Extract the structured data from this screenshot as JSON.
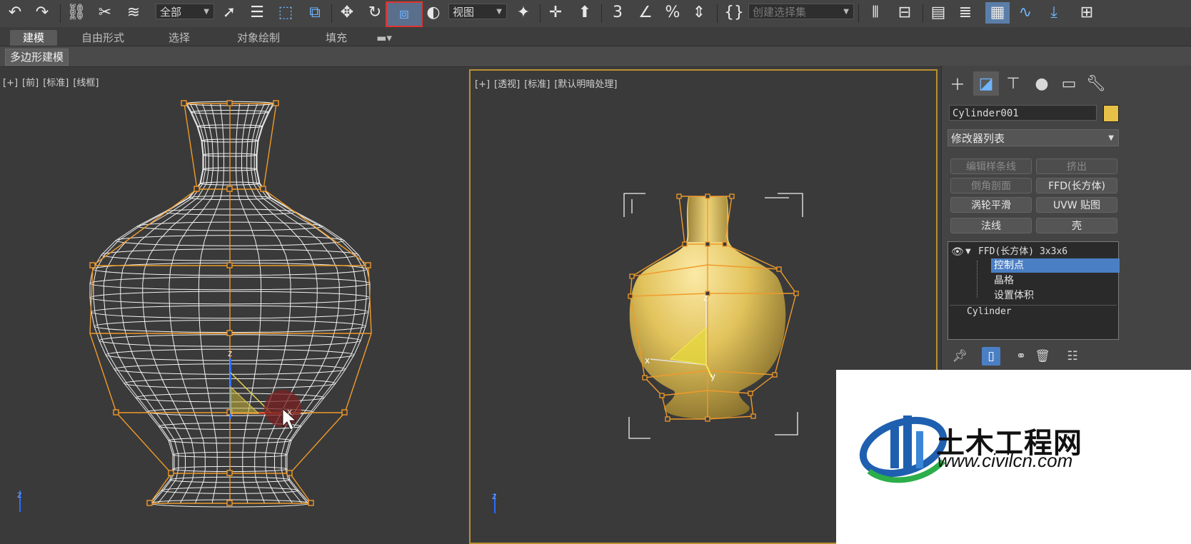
{
  "toolbar": {
    "selection_filter": "全部",
    "reference_coord": "视图",
    "named_selection_placeholder": "创建选择集",
    "snap_3d": "3",
    "percent_snap": "%"
  },
  "ribbon": {
    "tabs": [
      "建模",
      "自由形式",
      "选择",
      "对象绘制",
      "填充"
    ],
    "active_tab": "建模",
    "subtab": "多边形建模"
  },
  "viewport_left": {
    "label_parts": [
      "[+]",
      "[前]",
      "[标准]",
      "[线框]"
    ],
    "axis_z": "z",
    "axis_x": "x"
  },
  "viewport_right": {
    "label_parts": [
      "[+]",
      "[透视]",
      "[标准]",
      "[默认明暗处理]"
    ],
    "axis_z": "z",
    "axis_x": "x",
    "axis_y": "y"
  },
  "command_panel": {
    "object_name": "Cylinder001",
    "object_color": "#e7c147",
    "modifier_list": "修改器列表",
    "buttons": [
      {
        "label": "编辑样条线",
        "enabled": false
      },
      {
        "label": "挤出",
        "enabled": false
      },
      {
        "label": "倒角剖面",
        "enabled": false
      },
      {
        "label": "FFD(长方体)",
        "enabled": true
      },
      {
        "label": "涡轮平滑",
        "enabled": true
      },
      {
        "label": "UVW 贴图",
        "enabled": true
      },
      {
        "label": "法线",
        "enabled": true
      },
      {
        "label": "壳",
        "enabled": true
      }
    ],
    "stack": {
      "modifier": "FFD(长方体) 3x3x6",
      "sub_items": [
        "控制点",
        "晶格",
        "设置体积"
      ],
      "selected_sub": "控制点",
      "base": "Cylinder"
    }
  },
  "watermark": {
    "title": "土木工程网",
    "url": "www.civilcn.com"
  },
  "colors": {
    "accent_blue": "#4b7fc4",
    "ffd_orange": "#f09a2a",
    "vase_yellow": "#e2c35c",
    "active_viewport_border": "#b8902f"
  }
}
